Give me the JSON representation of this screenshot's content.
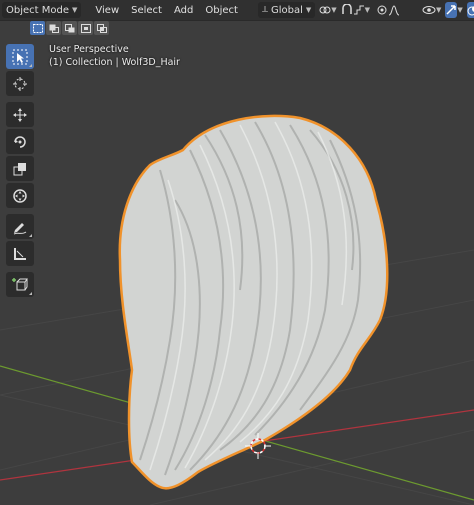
{
  "header": {
    "mode_label": "Object Mode",
    "menus": [
      "View",
      "Select",
      "Add",
      "Object"
    ],
    "transform_orientation": "Global"
  },
  "viewport": {
    "view_name": "User Perspective",
    "collection_line": "(1) Collection | Wolf3D_Hair"
  },
  "colors": {
    "selection_outline": "#f0922b",
    "active_tool": "#4772b3",
    "x_axis": "#b0343e",
    "y_axis": "#6c9a2f",
    "background": "#3d3d3d"
  },
  "toolbar": {
    "tools": [
      "select-box-icon",
      "cursor-icon",
      "move-icon",
      "rotate-icon",
      "scale-icon",
      "transform-icon",
      "annotate-icon",
      "measure-icon",
      "add-cube-icon"
    ]
  }
}
